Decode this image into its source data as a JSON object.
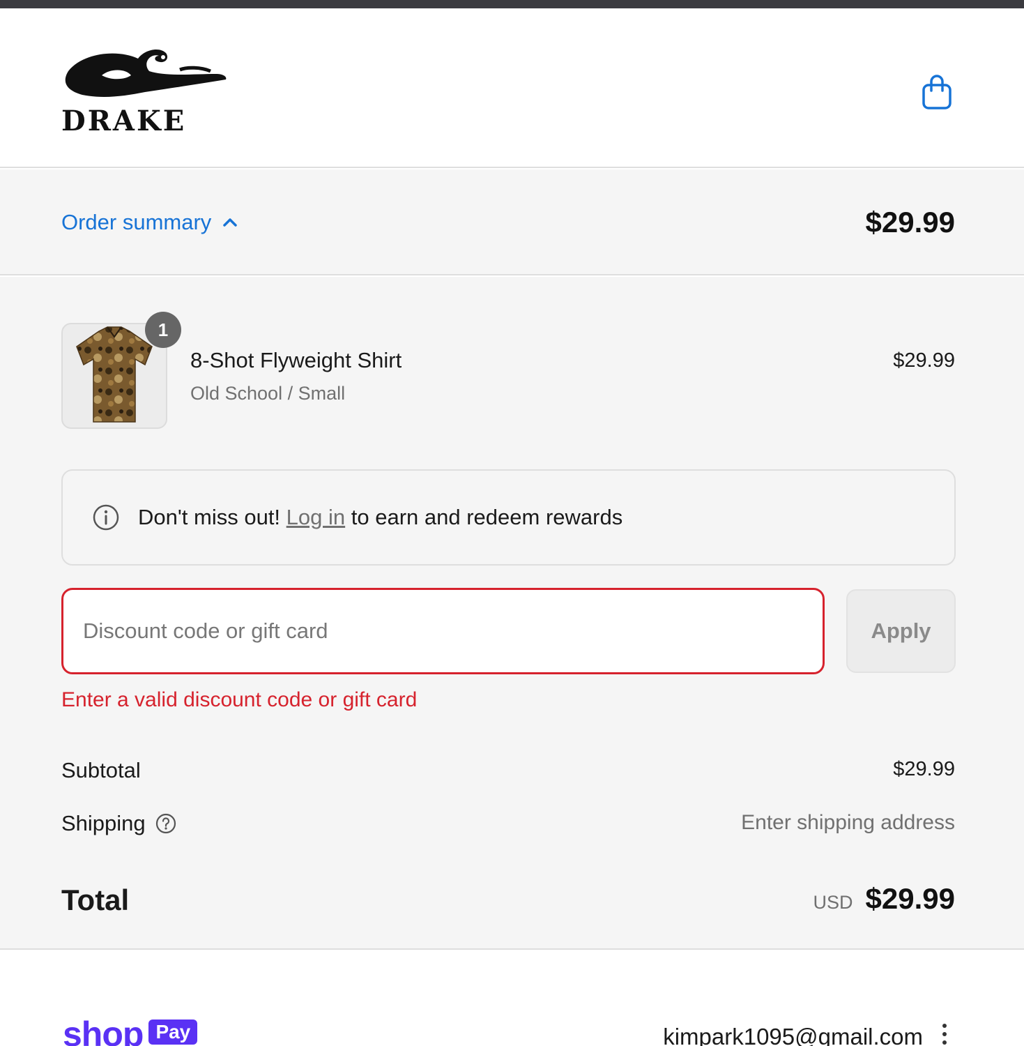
{
  "brand": {
    "name": "DRAKE"
  },
  "header": {
    "cart_icon": "shopping-bag-icon"
  },
  "summary": {
    "toggle_label": "Order summary",
    "toggle_icon": "chevron-up-icon",
    "total": "$29.99"
  },
  "product": {
    "quantity": "1",
    "name": "8-Shot Flyweight Shirt",
    "variant": "Old School / Small",
    "price": "$29.99"
  },
  "rewards": {
    "icon": "info-icon",
    "prefix": "Don't miss out!",
    "link_label": "Log in",
    "suffix": "to earn and redeem rewards"
  },
  "discount": {
    "placeholder": "Discount code or gift card",
    "value": "",
    "apply_label": "Apply",
    "error": "Enter a valid discount code or gift card"
  },
  "totals": {
    "subtotal_label": "Subtotal",
    "subtotal_value": "$29.99",
    "shipping_label": "Shipping",
    "shipping_icon": "help-circle-icon",
    "shipping_value": "Enter shipping address",
    "total_label": "Total",
    "currency": "USD",
    "total_value": "$29.99"
  },
  "footer": {
    "shop_word": "shop",
    "pay_label": "Pay",
    "email": "kimpark1095@gmail.com",
    "menu_icon": "more-vertical-icon"
  },
  "colors": {
    "link_blue": "#1773d6",
    "error_red": "#d6222d",
    "shop_purple": "#5a31f4",
    "panel_gray": "#f5f5f5"
  }
}
